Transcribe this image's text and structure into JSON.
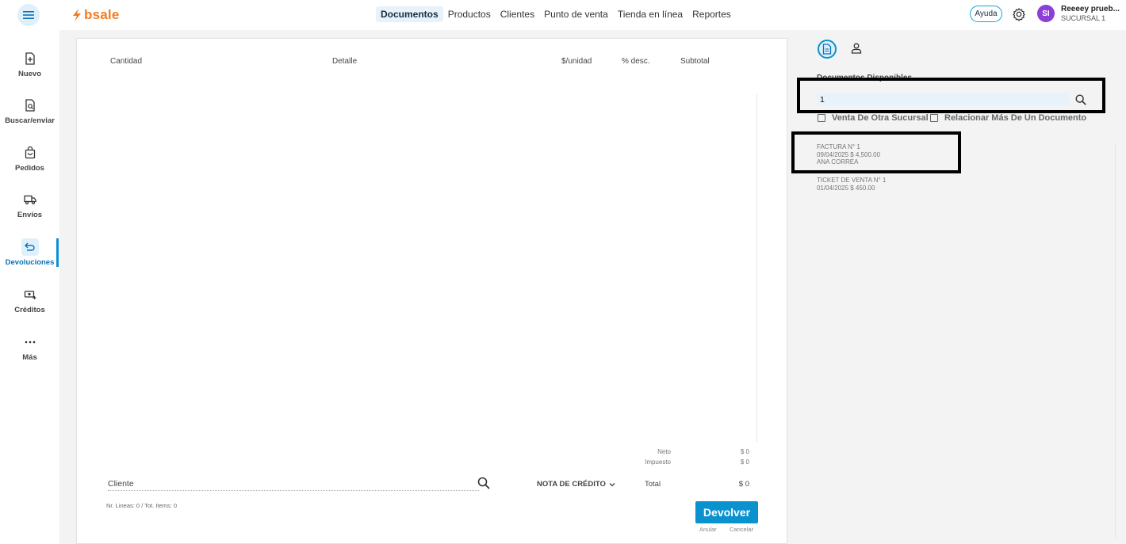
{
  "app": {
    "brand": "bsale"
  },
  "topnav": {
    "items": [
      {
        "label": "Documentos",
        "active": true
      },
      {
        "label": "Productos",
        "active": false
      },
      {
        "label": "Clientes",
        "active": false
      },
      {
        "label": "Punto de venta",
        "active": false
      },
      {
        "label": "Tienda en línea",
        "active": false
      },
      {
        "label": "Reportes",
        "active": false
      }
    ],
    "help_label": "Ayuda",
    "user_initials": "SI",
    "user_name": "Reeeey prueb...",
    "user_branch": "SUCURSAL 1"
  },
  "sidebar": {
    "items": [
      {
        "label": "Nuevo",
        "icon": "file-plus-icon"
      },
      {
        "label": "Buscar/enviar",
        "icon": "file-search-icon"
      },
      {
        "label": "Pedidos",
        "icon": "shopping-bag-icon"
      },
      {
        "label": "Envíos",
        "icon": "truck-icon"
      },
      {
        "label": "Devoluciones",
        "icon": "return-arrow-icon",
        "active": true
      },
      {
        "label": "Créditos",
        "icon": "money-icon"
      },
      {
        "label": "Más",
        "icon": "more-dots-icon"
      }
    ]
  },
  "table": {
    "headers": [
      "Cantidad",
      "Detalle",
      "$/unidad",
      "% desc.",
      "Subtotal"
    ]
  },
  "summary": {
    "neto_label": "Neto",
    "neto_value": "$ 0",
    "impuesto_label": "Impuesto",
    "impuesto_value": "$ 0",
    "total_label": "Total",
    "total_value": "$ 0"
  },
  "footer": {
    "client_placeholder": "Cliente",
    "doc_type": "NOTA DE CRÉDITO",
    "lines_info": "Nr. Lineas: 0 / Tot. Items: 0",
    "submit_label": "Devolver",
    "anular_label": "Anular",
    "cancelar_label": "Cancelar"
  },
  "right_panel": {
    "title": "Documentos Disponibles",
    "search_value": "1",
    "checkbox_other_branch": "Venta De Otra Sucursal",
    "checkbox_multiple": "Relacionar Más De Un Documento",
    "documents": [
      {
        "title": "FACTURA N° 1",
        "line2": "09/04/2025 $ 4,500.00",
        "line3": "ANA CORREA"
      },
      {
        "title": "TICKET DE VENTA N° 1",
        "line2": "01/04/2025 $ 450.00",
        "line3": ""
      }
    ]
  }
}
